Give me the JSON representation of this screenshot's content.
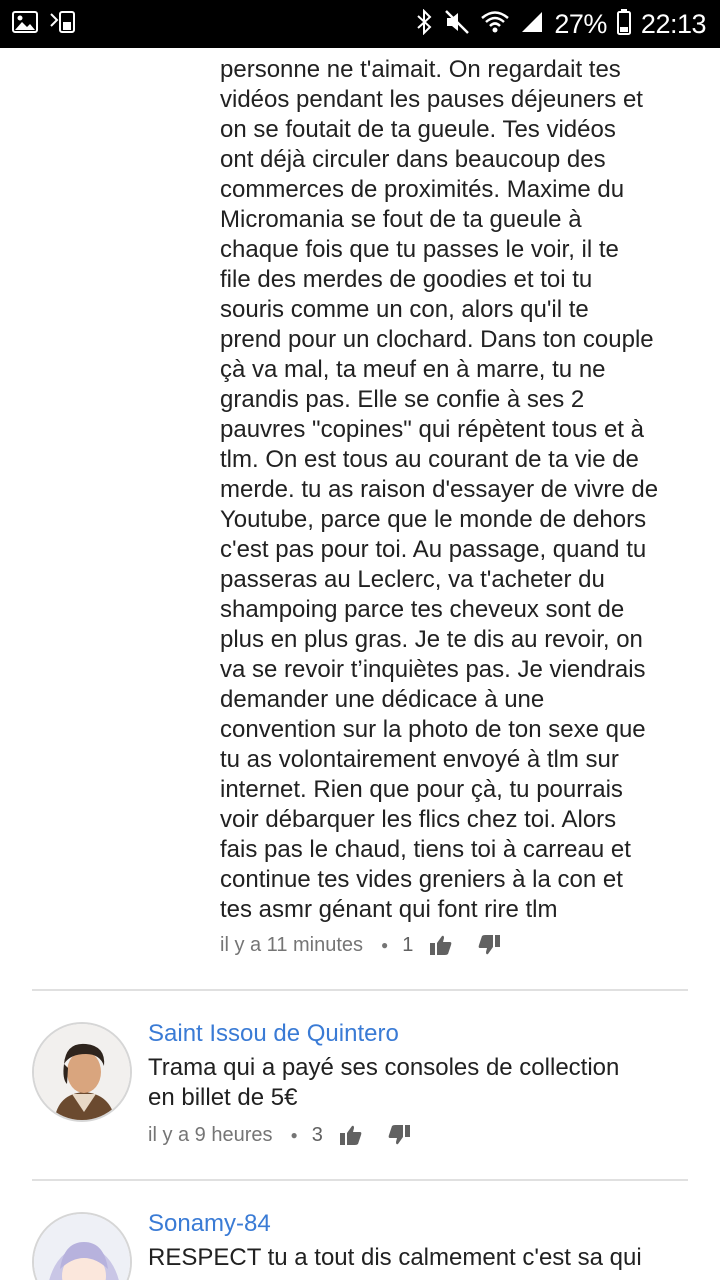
{
  "status_bar": {
    "icons_left": [
      "image-icon",
      "vibrate-icon"
    ],
    "icons_right": [
      "bluetooth-icon",
      "mute-icon",
      "wifi-icon",
      "signal-icon"
    ],
    "battery": "27%",
    "time": "22:13"
  },
  "comments": [
    {
      "text": "personne ne t'aimait. On regardait tes\nvidéos pendant les pauses déjeuners et\non se foutait de ta gueule. Tes vidéos\nont déjà circuler dans beaucoup des\ncommerces de proximités. Maxime du\nMicromania se fout de ta gueule à\nchaque fois que tu passes le voir, il te\nfile des merdes de goodies et toi tu\nsouris comme un con, alors qu'il te\nprend pour un clochard. Dans ton couple\nçà va mal, ta meuf en à marre, tu ne\ngrandis pas. Elle se confie à ses 2\npauvres \"copines\" qui répètent tous et à\ntlm. On est tous au courant de ta vie de\nmerde. tu as raison d'essayer de vivre de\nYoutube, parce que le monde de dehors\nc'est pas pour toi. Au passage, quand tu\npasseras au Leclerc, va t'acheter du\nshampoing parce tes cheveux sont de\nplus en plus gras. Je te dis au revoir, on\nva se revoir t’inquiètes pas. Je viendrais\ndemander une dédicace à une\nconvention sur la photo de ton sexe que\ntu as volontairement envoyé à tlm sur\ninternet. Rien que pour çà, tu pourrais\nvoir débarquer les flics chez toi. Alors\nfais pas le chaud, tiens toi à carreau et\ncontinue tes vides greniers à la con et\ntes asmr génant qui font rire tlm",
      "time": "il y a 11 minutes",
      "likes": "1"
    },
    {
      "author": "Saint Issou de Quintero",
      "text": "Trama qui a payé ses consoles de collection\nen billet de 5€",
      "time": "il y a 9 heures",
      "likes": "3"
    },
    {
      "author": "Sonamy-84",
      "text": "RESPECT tu a tout dis calmement c'est sa qui",
      "time": "",
      "likes": ""
    }
  ],
  "colors": {
    "author": "#3a7bd5",
    "text": "#212121",
    "meta": "#757575"
  }
}
